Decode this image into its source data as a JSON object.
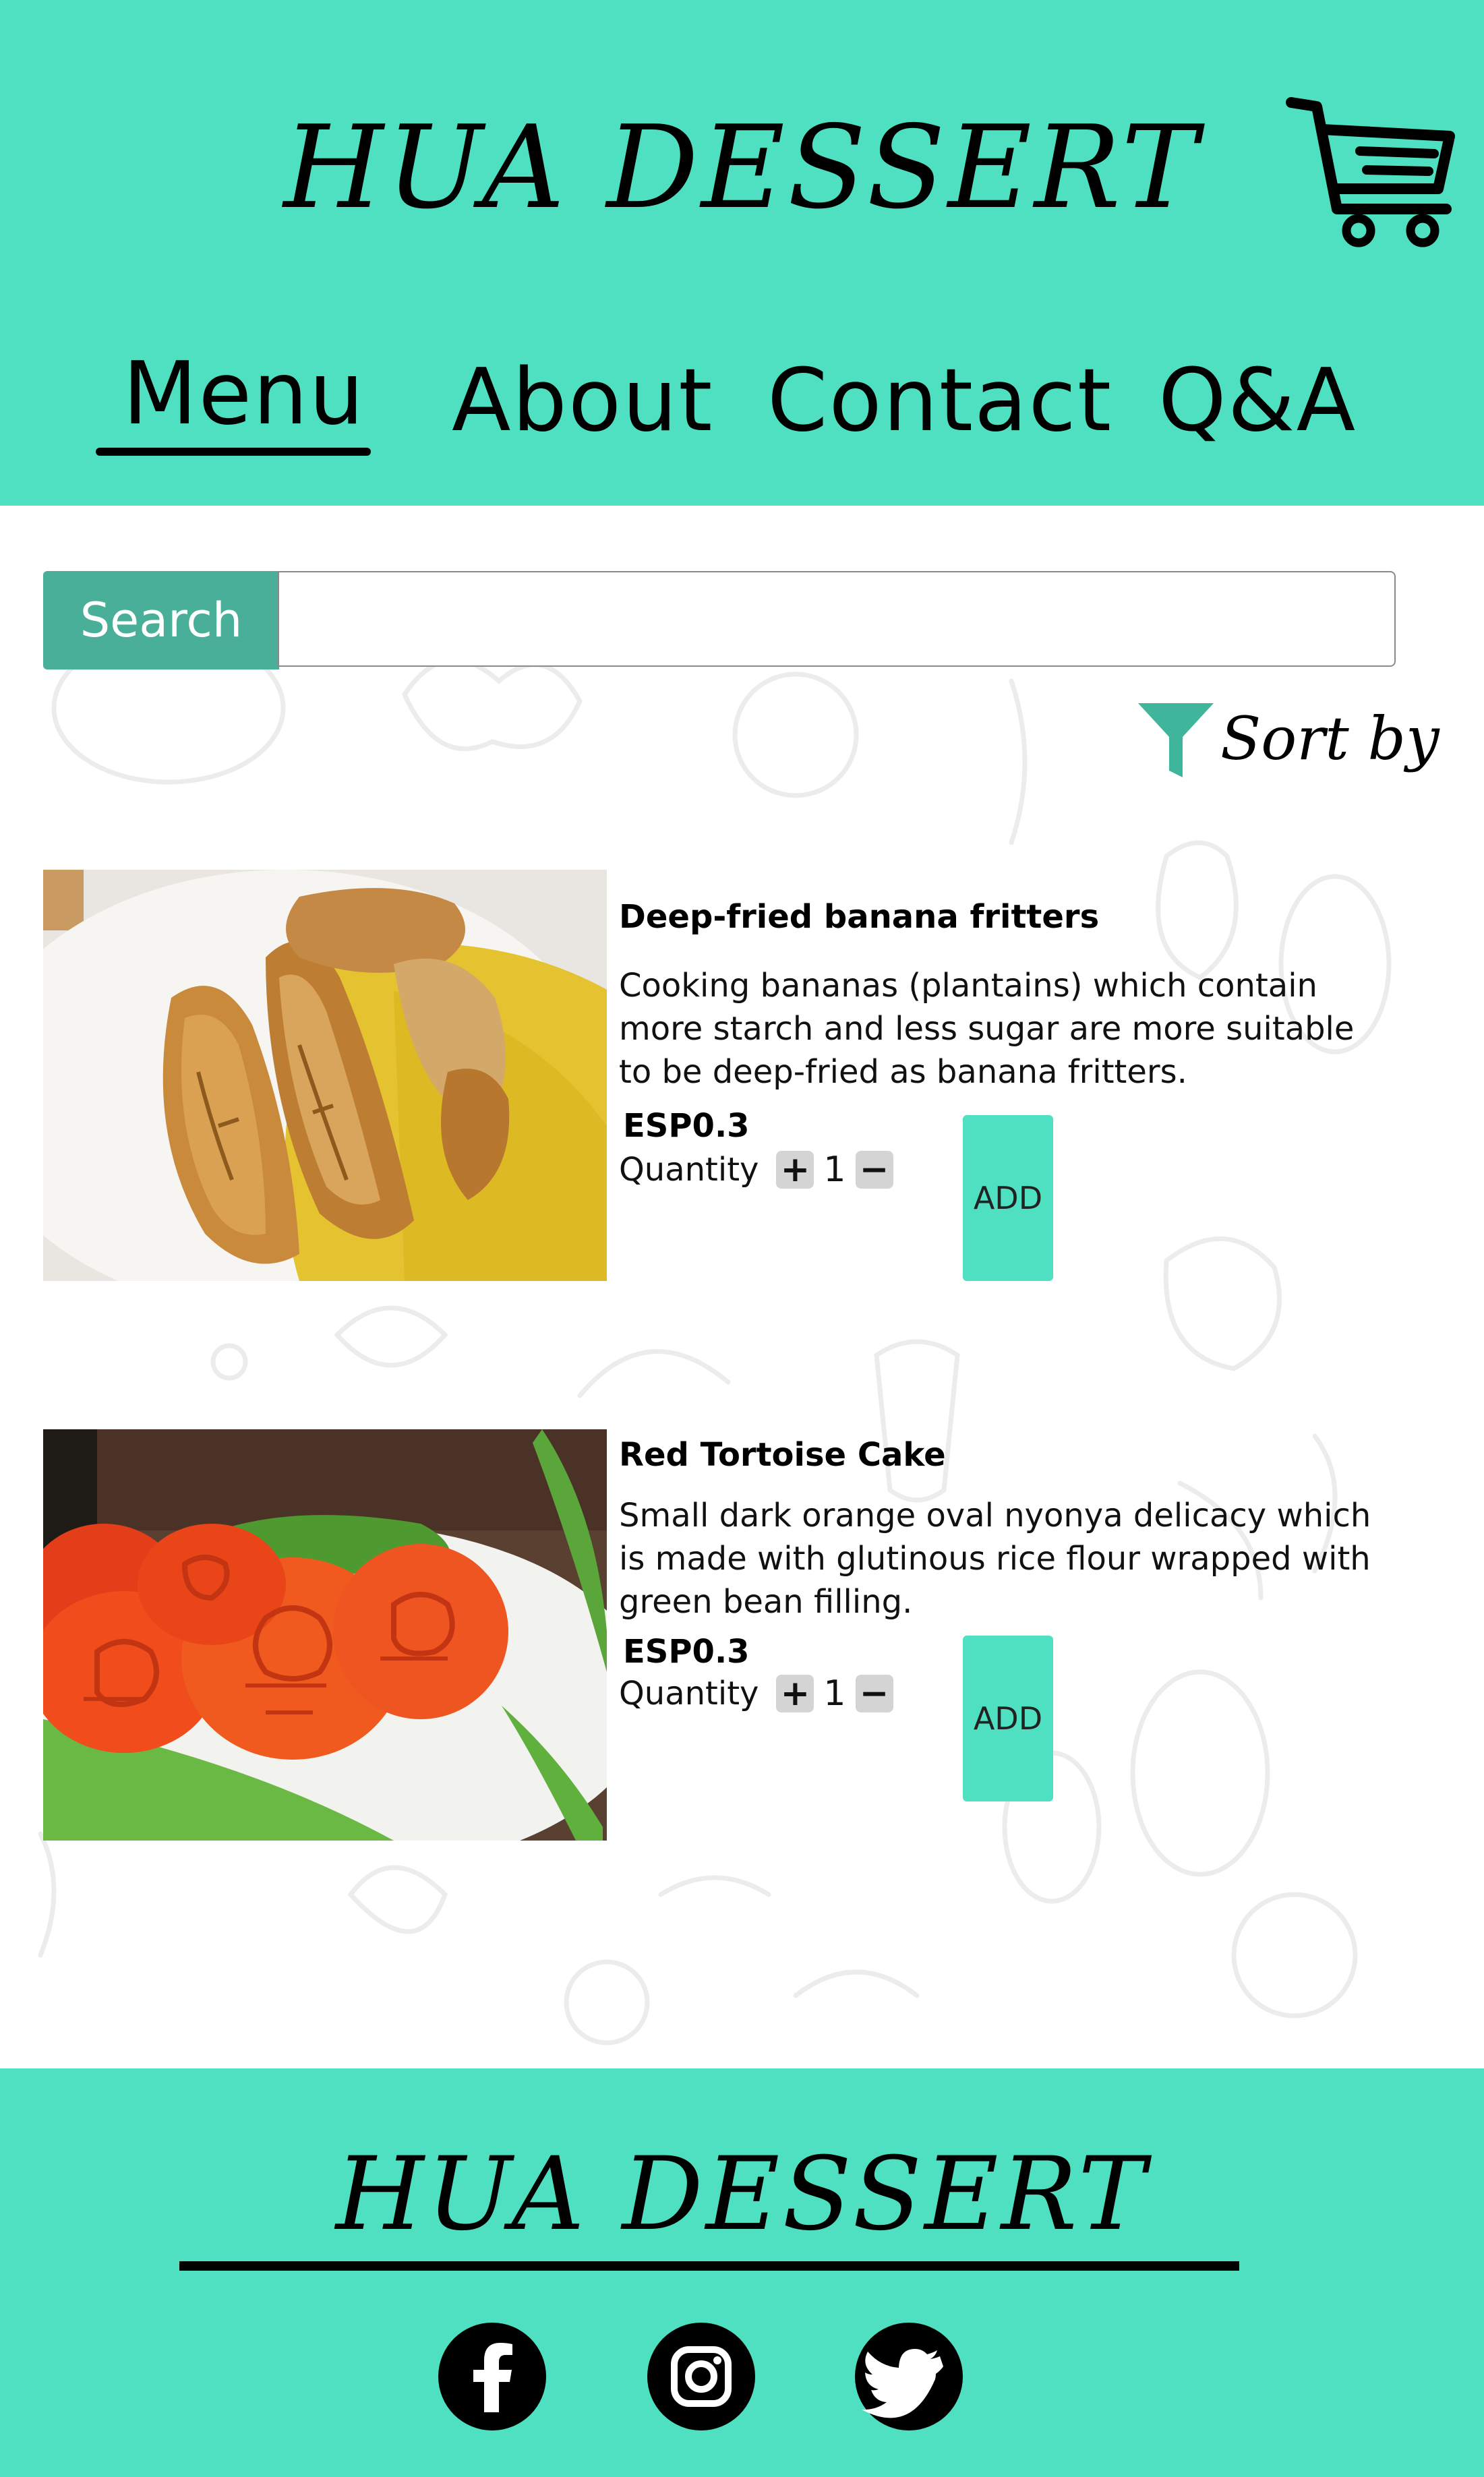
{
  "brand": {
    "title": "HUA DESSERT"
  },
  "header": {
    "cart_icon": "shopping-cart-icon",
    "nav": [
      {
        "label": "Menu",
        "active": true
      },
      {
        "label": "About",
        "active": false
      },
      {
        "label": "Contact",
        "active": false
      },
      {
        "label": "Q&A",
        "active": false
      }
    ]
  },
  "search": {
    "button_label": "Search",
    "value": "",
    "placeholder": ""
  },
  "sort": {
    "label": "Sort by",
    "icon": "filter-icon"
  },
  "products": [
    {
      "title": "Deep-fried banana fritters",
      "description": "Cooking bananas (plantains) which contain more starch and less sugar are more suitable to be deep-fried as banana fritters.",
      "price": "ESP0.3",
      "quantity_label": "Quantity",
      "quantity": "1",
      "plus": "+",
      "minus": "−",
      "add_label": "ADD"
    },
    {
      "title": "Red Tortoise Cake",
      "description": "Small dark orange oval nyonya delicacy which is made with glutinous rice flour wrapped with green bean filling.",
      "price": "ESP0.3",
      "quantity_label": "Quantity",
      "quantity": "1",
      "plus": "+",
      "minus": "−",
      "add_label": "ADD"
    }
  ],
  "footer": {
    "title": "HUA DESSERT",
    "social": [
      "facebook-icon",
      "instagram-icon",
      "twitter-icon"
    ]
  },
  "colors": {
    "accent": "#4ee0c1",
    "search_button": "#4aaf98",
    "sort_icon": "#3fb59b",
    "qty_button": "#d4d4d4"
  }
}
